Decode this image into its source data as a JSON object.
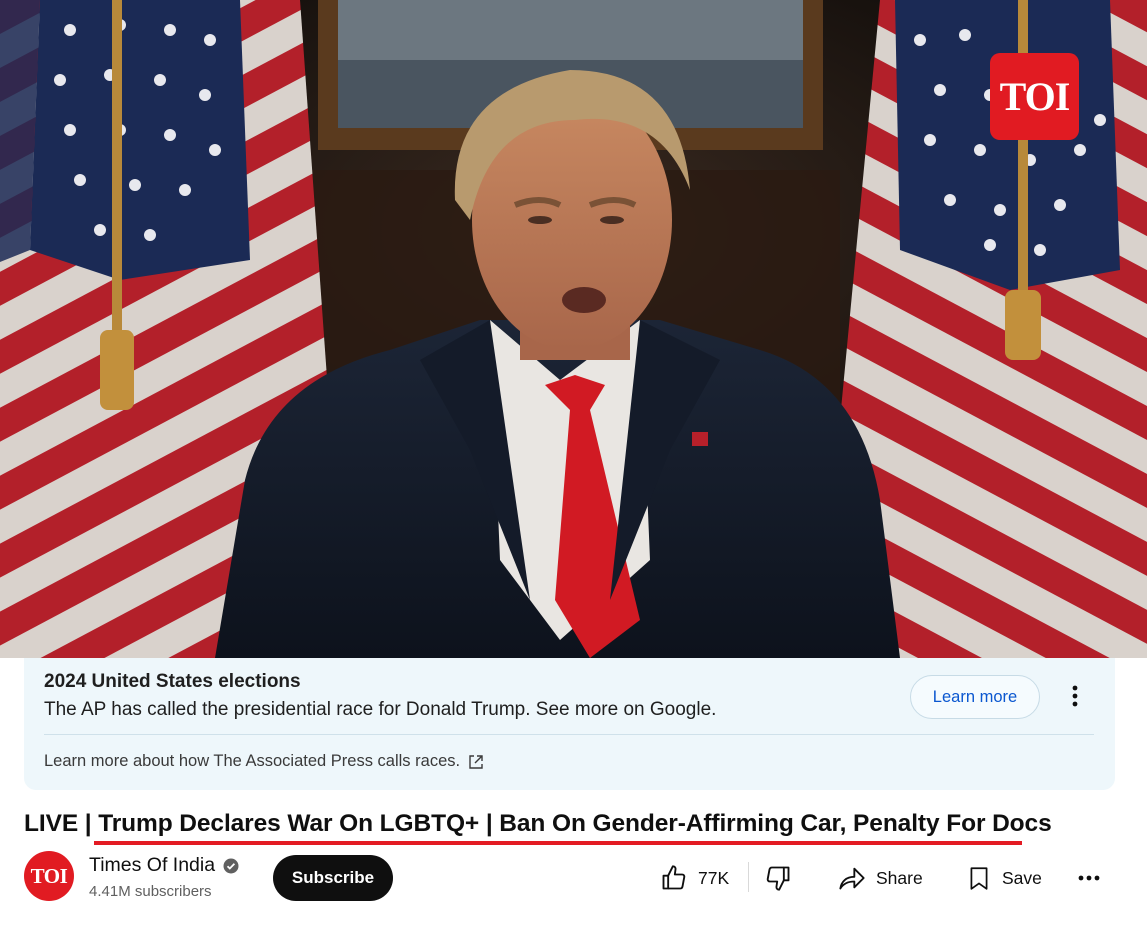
{
  "video": {
    "watermark": "TOI"
  },
  "info_panel": {
    "title": "2024 United States elections",
    "description": "The AP has called the presidential race for Donald Trump. See more on Google.",
    "learn_more_label": "Learn more",
    "footer_link": "Learn more about how The Associated Press calls races."
  },
  "title": {
    "prefix": "LIVE | ",
    "main": "Trump Declares War On LGBTQ+ | Ban On Gender-Affirming Car, Penalty For Docs"
  },
  "channel": {
    "avatar_text": "TOI",
    "name": "Times Of India",
    "subscribers": "4.41M subscribers",
    "subscribe_label": "Subscribe",
    "verified_icon": "verified-check-icon"
  },
  "actions": {
    "likes": "77K",
    "share_label": "Share",
    "save_label": "Save"
  },
  "colors": {
    "brand_red": "#e11b22",
    "underline_red": "#e31b23",
    "panel_bg": "#eef7fb",
    "link_blue": "#0b57d0"
  }
}
